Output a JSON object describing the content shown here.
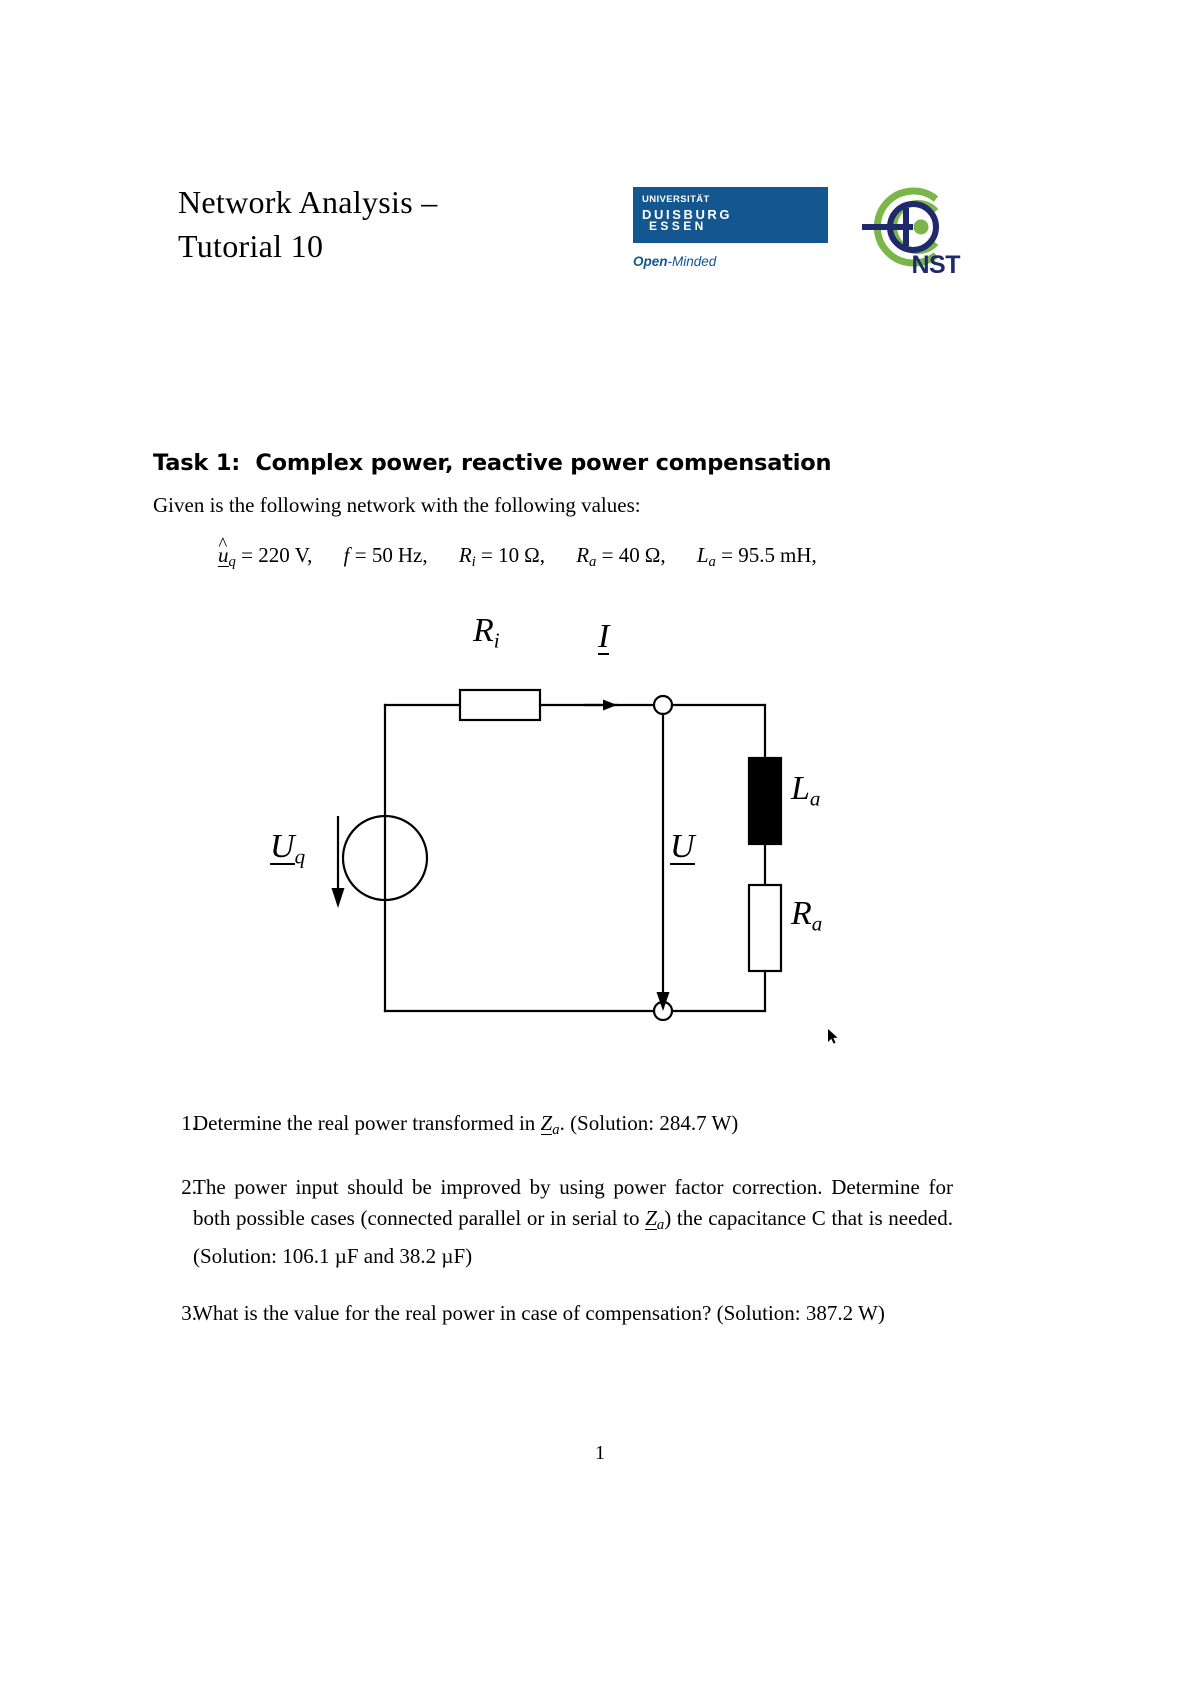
{
  "header": {
    "title_line1": "Network Analysis –",
    "title_line2": "Tutorial 10",
    "ude_logo": {
      "line_universitat": "UNIVERSITÄT",
      "line_duisburg": "DUISBURG",
      "line_essen": "ESSEN",
      "tagline_bold": "Open",
      "tagline_rest": "-Minded",
      "box_color": "#14568f",
      "text_color": "#ffffff"
    },
    "nst_logo": {
      "text": "NST",
      "arc_color": "#7ab648",
      "ring_color": "#1e2a6b",
      "dot_color": "#7ab648"
    }
  },
  "task": {
    "heading": "Task 1:  Complex power, reactive power compensation",
    "intro": "Given is the following network with the following values:",
    "given_values": [
      {
        "symbol": "û",
        "symbol_sub": "q",
        "underlined": true,
        "value": "220",
        "unit": "V"
      },
      {
        "symbol": "f",
        "symbol_sub": "",
        "underlined": false,
        "value": "50",
        "unit": "Hz"
      },
      {
        "symbol": "R",
        "symbol_sub": "i",
        "underlined": false,
        "value": "10",
        "unit": "Ω"
      },
      {
        "symbol": "R",
        "symbol_sub": "a",
        "underlined": false,
        "value": "40",
        "unit": "Ω"
      },
      {
        "symbol": "L",
        "symbol_sub": "a",
        "underlined": false,
        "value": "95.5",
        "unit": "mH"
      }
    ]
  },
  "circuit": {
    "labels": {
      "source": "U",
      "source_sub": "q",
      "resistor_internal": "R",
      "resistor_internal_sub": "i",
      "current": "I",
      "voltage": "U",
      "inductor": "L",
      "inductor_sub": "a",
      "resistor_load": "R",
      "resistor_load_sub": "a"
    }
  },
  "questions": [
    {
      "number": "1.",
      "text_before": "Determine the real power transformed in ",
      "symbol": "Z",
      "symbol_sub": "a",
      "text_after": ". (Solution: 284.7 W)"
    },
    {
      "number": "2.",
      "text_before": "The power input should be improved by using power factor correction. Determine for both possible cases (connected parallel or in serial to ",
      "symbol": "Z",
      "symbol_sub": "a",
      "text_after": ") the capacitance C that is needed. (Solution: 106.1 µF and 38.2 µF)"
    },
    {
      "number": "3.",
      "text_before": "What is the value for the real power in case of compensation?  (Solution: 387.2 W)",
      "symbol": "",
      "symbol_sub": "",
      "text_after": ""
    }
  ],
  "footer": {
    "page_number": "1"
  }
}
